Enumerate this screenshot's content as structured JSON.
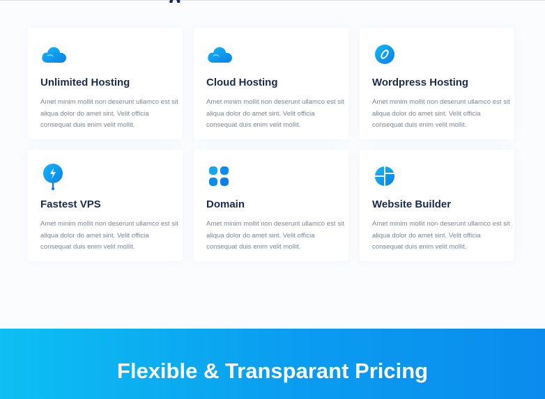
{
  "colors": {
    "heading": "#1b2a4a",
    "body_text": "#7d8594",
    "icon_blue": "#0a8cee",
    "icon_cyan": "#15b8f5",
    "band_start": "#0dbff2",
    "band_end": "#0a8cee"
  },
  "services": [
    {
      "icon": "cloud-icon",
      "title": "Unlimited Hosting",
      "description": "Amet minim mollit non deserunt ullamco est sit aliqua dolor do amet sint. Velit officia consequat duis enim velit mollit."
    },
    {
      "icon": "cloud-icon",
      "title": "Cloud Hosting",
      "description": "Amet minim mollit non deserunt ullamco est sit aliqua dolor do amet sint. Velit officia consequat duis enim velit mollit."
    },
    {
      "icon": "wordpress-icon",
      "title": "Wordpress Hosting",
      "description": "Amet minim mollit non deserunt ullamco est sit aliqua dolor do amet sint. Velit officia consequat duis enim velit mollit."
    },
    {
      "icon": "lightning-pin-icon",
      "title": "Fastest VPS",
      "description": "Amet minim mollit non deserunt ullamco est sit aliqua dolor do amet sint. Velit officia consequat duis enim velit mollit."
    },
    {
      "icon": "grid-dots-icon",
      "title": "Domain",
      "description": "Amet minim mollit non deserunt ullamco est sit aliqua dolor do amet sint. Velit officia consequat duis enim velit mollit."
    },
    {
      "icon": "pie-chart-icon",
      "title": "Website Builder",
      "description": "Amet minim mollit non deserunt ullamco est sit aliqua dolor do amet sint. Velit officia consequat duis enim velit mollit."
    }
  ],
  "pricing": {
    "title": "Flexible & Transparant Pricing"
  }
}
